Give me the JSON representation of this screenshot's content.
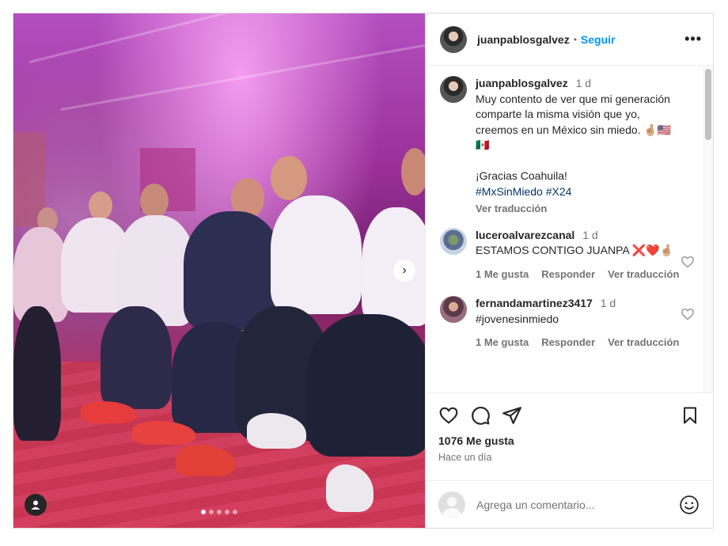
{
  "post": {
    "author": "juanpablosgalvez",
    "follow_label": "Seguir",
    "separator": "•",
    "more_label": "•••",
    "photo": {
      "dots": 5,
      "active_dot": 1
    }
  },
  "caption": {
    "author": "juanpablosgalvez",
    "time": "1 d",
    "text": "Muy contento de ver que mi generación comparte la misma visión que yo, creemos en un México sin miedo. 🤞🏼🇺🇸🇲🇽\n\n¡Gracias Coahuila!\n",
    "hashtags": "#MxSinMiedo #X24",
    "translate": "Ver traducción"
  },
  "comments": [
    {
      "author": "luceroalvarezcanal",
      "time": "1 d",
      "text": "ESTAMOS CONTIGO JUANPA ❌❤️🤞🏼",
      "likes": "1 Me gusta",
      "reply": "Responder",
      "translate": "Ver traducción"
    },
    {
      "author": "fernandamartinez3417",
      "time": "1 d",
      "text": "#jovenesinmiedo",
      "likes": "1 Me gusta",
      "reply": "Responder",
      "translate": "Ver traducción"
    }
  ],
  "stats": {
    "likes": "1076 Me gusta",
    "when": "Hace un día"
  },
  "add_comment": {
    "placeholder": "Agrega un comentario...",
    "emoji": "☺"
  },
  "colors": {
    "link": "#0095f6",
    "hashtag": "#00376b",
    "muted": "#737373"
  }
}
